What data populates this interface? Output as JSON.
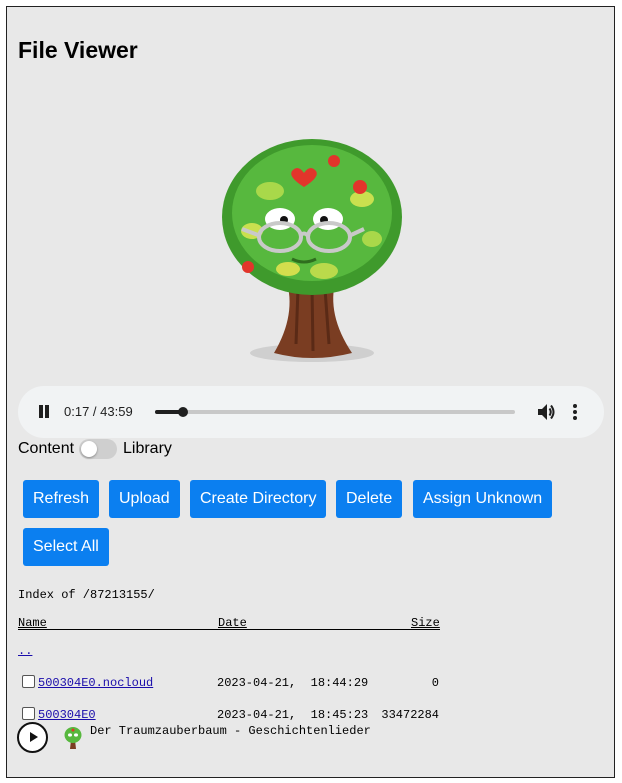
{
  "page": {
    "title": "File Viewer"
  },
  "player": {
    "state": "playing",
    "time_display": "0:17 / 43:59",
    "progress": 0.0064,
    "icons": {
      "pause": "pause-icon",
      "volume": "volume-icon",
      "more": "more-vert-icon"
    }
  },
  "toggle": {
    "left_label": "Content",
    "right_label": "Library",
    "checked": false
  },
  "toolbar": {
    "refresh": "Refresh",
    "upload": "Upload",
    "create_directory": "Create Directory",
    "delete": "Delete",
    "assign_unknown": "Assign Unknown",
    "select_all": "Select All"
  },
  "listing": {
    "index_title": "Index of /87213155/",
    "columns": {
      "name": "Name",
      "date": "Date",
      "size": "Size"
    },
    "parent_link": "..",
    "rows": [
      {
        "name": "500304E0.nocloud",
        "date": "2023-04-21,  18:44:29",
        "size": "0"
      },
      {
        "name": "500304E0",
        "date": "2023-04-21,  18:45:23",
        "size": "33472284"
      }
    ]
  },
  "now_playing": {
    "title": "Der Traumzauberbaum - Geschichtenlieder"
  },
  "colors": {
    "button": "#0b7ff0",
    "background": "#e8e8e8",
    "link": "#1a0dab"
  }
}
